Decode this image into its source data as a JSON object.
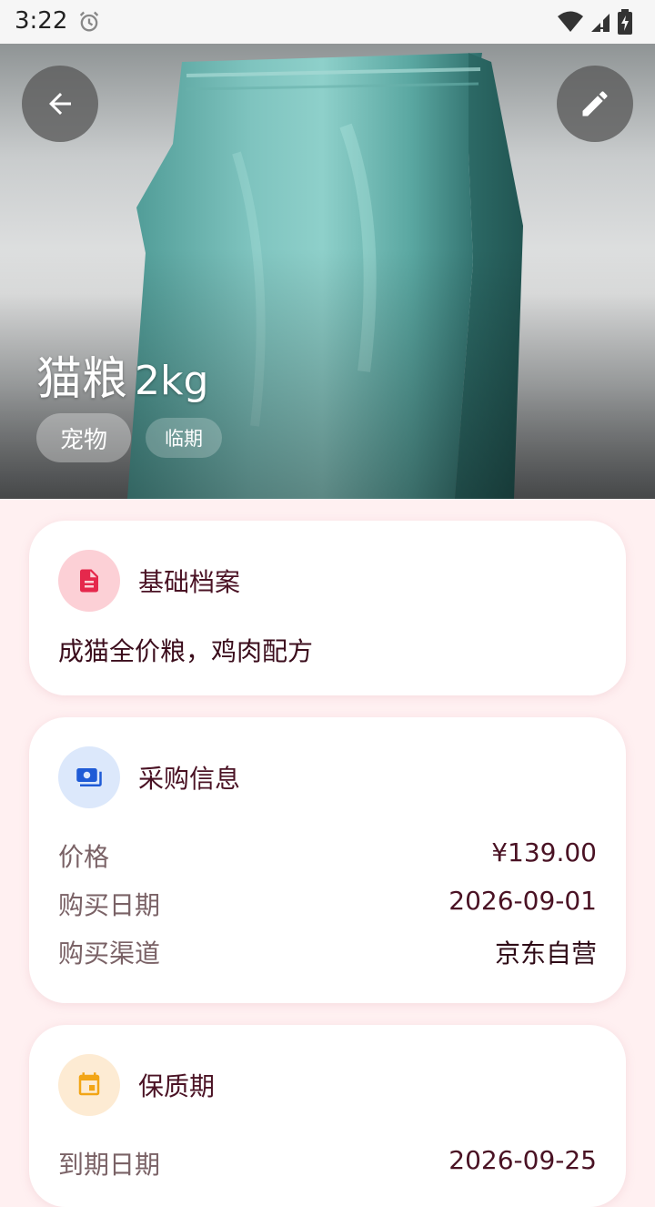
{
  "status_bar": {
    "time": "3:22",
    "icons": [
      "alarm-icon",
      "wifi-icon",
      "signal-icon",
      "battery-charging-icon"
    ]
  },
  "header": {
    "title": "猫粮",
    "quantity": "2kg",
    "tags": [
      "宠物",
      "临期"
    ],
    "back_icon": "arrow-back-icon",
    "edit_icon": "pencil-icon"
  },
  "basic_info": {
    "title": "基础档案",
    "icon": "document-icon",
    "icon_color": "#E5284C",
    "description": "成猫全价粮，鸡肉配方"
  },
  "purchase_info": {
    "title": "采购信息",
    "icon": "payments-icon",
    "icon_color": "#1F5BD6",
    "rows": [
      {
        "label": "价格",
        "value": "¥139.00"
      },
      {
        "label": "购买日期",
        "value": "2026-09-01"
      },
      {
        "label": "购买渠道",
        "value": "京东自营"
      }
    ]
  },
  "shelf_life": {
    "title": "保质期",
    "icon": "calendar-icon",
    "icon_color": "#F2A516",
    "rows": [
      {
        "label": "到期日期",
        "value": "2026-09-25"
      }
    ]
  },
  "colors": {
    "page_bg": "#FFF0F1",
    "title_text": "#4A1224",
    "label_text": "#7A6266"
  }
}
